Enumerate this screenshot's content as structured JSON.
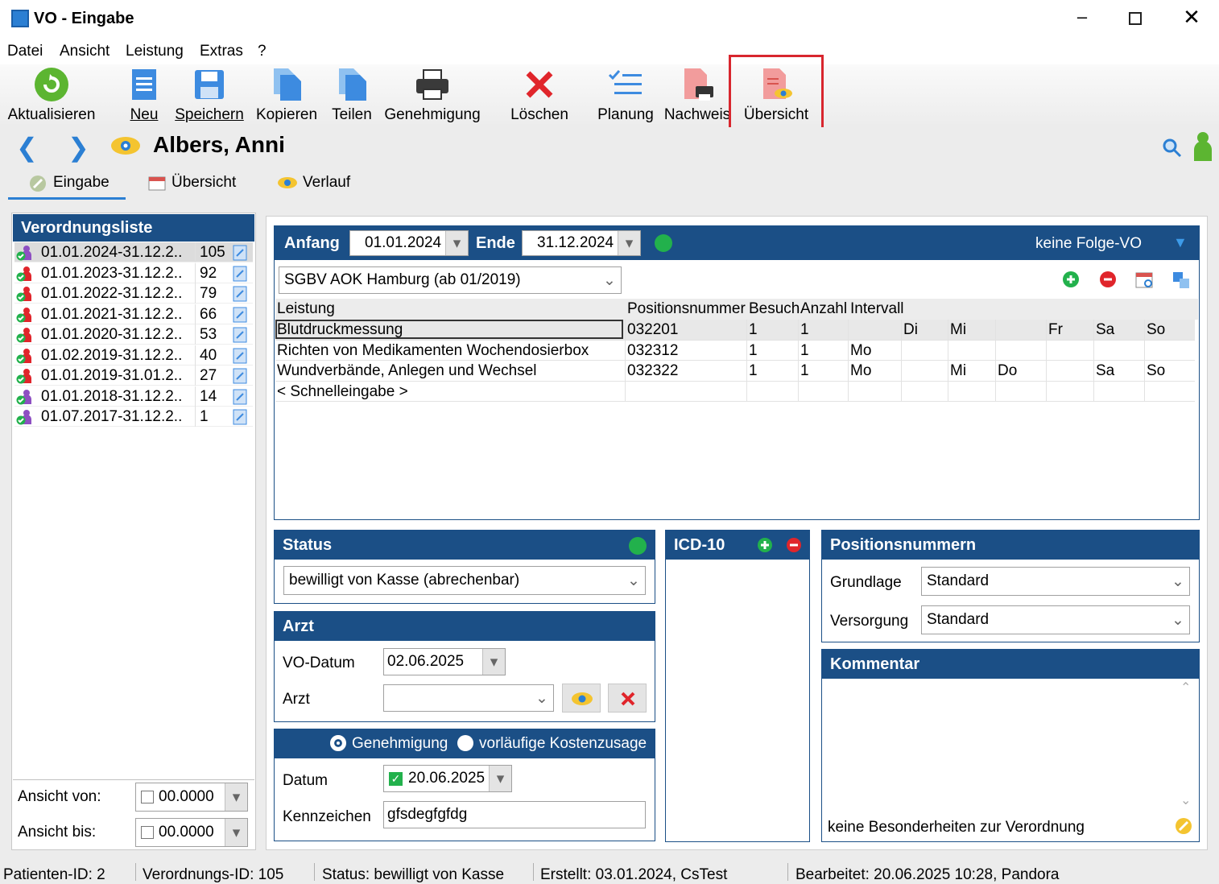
{
  "window": {
    "title": "VO - Eingabe"
  },
  "menu": [
    "Datei",
    "Ansicht",
    "Leistung",
    "Extras",
    "?"
  ],
  "toolbar": {
    "refresh": "Aktualisieren",
    "new": "Neu",
    "save": "Speichern",
    "copy": "Kopieren",
    "split": "Teilen",
    "approval": "Genehmigung",
    "delete": "Löschen",
    "planning": "Planung",
    "proof": "Nachweis",
    "overview": "Übersicht"
  },
  "patient": {
    "name": "Albers, Anni"
  },
  "tabs": {
    "input": "Eingabe",
    "overview": "Übersicht",
    "history": "Verlauf"
  },
  "vo_list": {
    "title": "Verordnungsliste",
    "rows": [
      {
        "range": "01.01.2024-31.12.2..",
        "id": "105"
      },
      {
        "range": "01.01.2023-31.12.2..",
        "id": "92"
      },
      {
        "range": "01.01.2022-31.12.2..",
        "id": "79"
      },
      {
        "range": "01.01.2021-31.12.2..",
        "id": "66"
      },
      {
        "range": "01.01.2020-31.12.2..",
        "id": "53"
      },
      {
        "range": "01.02.2019-31.12.2..",
        "id": "40"
      },
      {
        "range": "01.01.2019-31.01.2..",
        "id": "27"
      },
      {
        "range": "01.01.2018-31.12.2..",
        "id": "14"
      },
      {
        "range": "01.07.2017-31.12.2..",
        "id": "1"
      }
    ],
    "view_from_label": "Ansicht von:",
    "view_from_value": "00.0000",
    "view_to_label": "Ansicht bis:",
    "view_to_value": "00.0000"
  },
  "vo": {
    "start_label": "Anfang",
    "start": "01.01.2024",
    "end_label": "Ende",
    "end": "31.12.2024",
    "follow": "keine Folge-VO",
    "contract": "SGBV AOK Hamburg (ab 01/2019)",
    "grid_headers": {
      "service": "Leistung",
      "pos": "Positionsnummer",
      "visit": "Besuch",
      "count": "Anzahl",
      "interval": "Intervall"
    },
    "grid_rows": [
      {
        "service": "Blutdruckmessung",
        "pos": "032201",
        "visit": "1",
        "count": "1",
        "mo": "",
        "di": "Di",
        "mi": "Mi",
        "do": "",
        "fr": "Fr",
        "sa": "Sa",
        "so": "So"
      },
      {
        "service": "Richten von Medikamenten Wochendosierbox",
        "pos": "032312",
        "visit": "1",
        "count": "1",
        "mo": "Mo",
        "di": "",
        "mi": "",
        "do": "",
        "fr": "",
        "sa": "",
        "so": ""
      },
      {
        "service": "Wundverbände, Anlegen und Wechsel",
        "pos": "032322",
        "visit": "1",
        "count": "1",
        "mo": "Mo",
        "di": "",
        "mi": "Mi",
        "do": "Do",
        "fr": "",
        "sa": "Sa",
        "so": "So"
      }
    ],
    "quick_entry": "< Schnelleingabe >"
  },
  "status": {
    "title": "Status",
    "value": "bewilligt von Kasse (abrechenbar)"
  },
  "doctor": {
    "title": "Arzt",
    "date_label": "VO-Datum",
    "date": "02.06.2025",
    "doctor_label": "Arzt",
    "doctor": ""
  },
  "approval": {
    "opt1": "Genehmigung",
    "opt2": "vorläufige Kostenzusage",
    "date_label": "Datum",
    "date": "20.06.2025",
    "sign_label": "Kennzeichen",
    "sign": "gfsdegfgfdg"
  },
  "icd": {
    "title": "ICD-10"
  },
  "positions": {
    "title": "Positionsnummern",
    "base_label": "Grundlage",
    "base": "Standard",
    "supply_label": "Versorgung",
    "supply": "Standard"
  },
  "comment": {
    "title": "Kommentar",
    "text": "keine Besonderheiten zur Verordnung"
  },
  "statusbar": {
    "patient": "Patienten-ID: 2",
    "vo": "Verordnungs-ID: 105",
    "status": "Status: bewilligt von Kasse",
    "created": "Erstellt: 03.01.2024, CsTest",
    "edited": "Bearbeitet: 20.06.2025 10:28, Pandora"
  },
  "colors": {
    "header": "#1b4f86",
    "highlight": "#d8262e",
    "ok": "#22b14c"
  }
}
